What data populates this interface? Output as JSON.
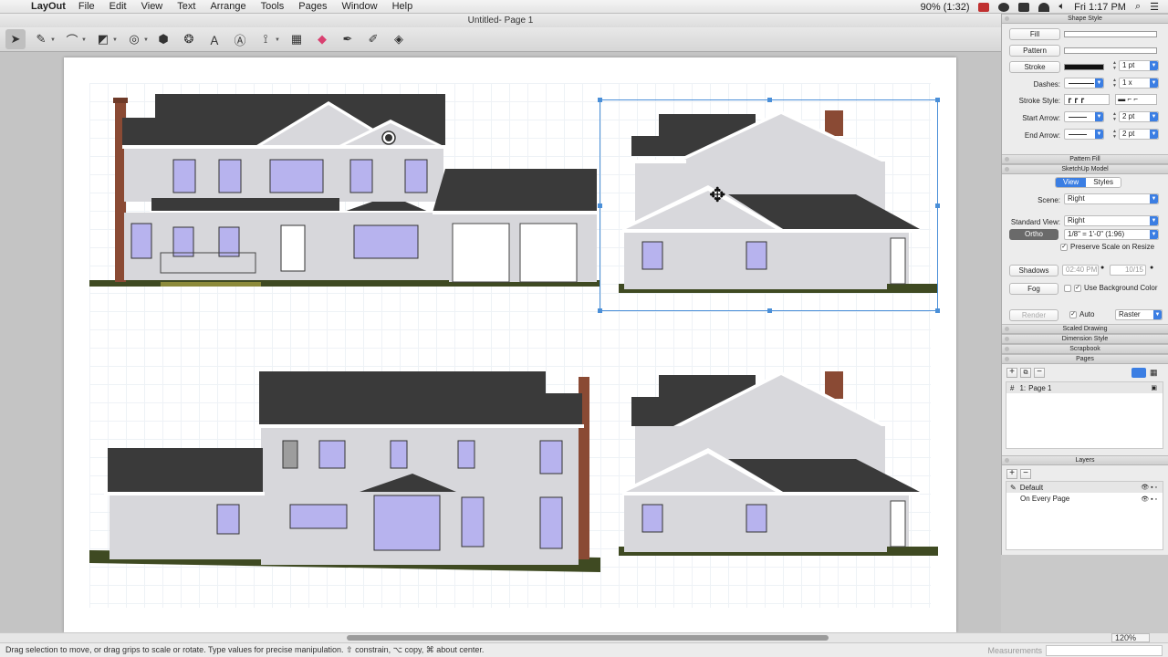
{
  "menubar": {
    "app": "LayOut",
    "menus": [
      "File",
      "Edit",
      "View",
      "Text",
      "Arrange",
      "Tools",
      "Pages",
      "Window",
      "Help"
    ],
    "battery": "90% (1:32)",
    "clock": "Fri 1:17 PM"
  },
  "window": {
    "title": "Untitled- Page 1"
  },
  "toolbar": {
    "tools": [
      "select-tool",
      "pencil-tool",
      "arc-tool",
      "shape-tool",
      "circle-tool",
      "rotate-tool",
      "split-tool",
      "text-tool",
      "label-tool",
      "dimension-tool",
      "table-tool",
      "eraser-tool",
      "style-tool",
      "sample-tool",
      "paint-bucket-tool"
    ]
  },
  "canvas": {
    "zoom": "120%",
    "accent": "#4a8fd8"
  },
  "status": {
    "hint": "Drag selection to move, or drag grips to scale or rotate. Type values for precise manipulation. ⇧ constrain, ⌥ copy, ⌘ about center.",
    "measurements_label": "Measurements"
  },
  "panel": {
    "shape_style": {
      "title": "Shape Style",
      "fill": "Fill",
      "pattern": "Pattern",
      "stroke": "Stroke",
      "stroke_width": "1 pt",
      "dashes_label": "Dashes:",
      "dashes_scale": "1 x",
      "stroke_style_label": "Stroke Style:",
      "start_arrow_label": "Start Arrow:",
      "start_arrow_size": "2 pt",
      "end_arrow_label": "End Arrow:",
      "end_arrow_size": "2 pt"
    },
    "pattern_fill": {
      "title": "Pattern Fill"
    },
    "sketchup_model": {
      "title": "SketchUp Model",
      "tab_view": "View",
      "tab_styles": "Styles",
      "scene_label": "Scene:",
      "scene_value": "Right",
      "standard_view_label": "Standard View:",
      "standard_view_value": "Right",
      "ortho": "Ortho",
      "scale_value": "1/8\" = 1'-0\" (1:96)",
      "preserve_scale": "Preserve Scale on Resize",
      "shadows": "Shadows",
      "shadow_time": "02:40 PM",
      "shadow_date": "10/15",
      "fog": "Fog",
      "use_background": "Use Background Color",
      "render": "Render",
      "auto": "Auto",
      "render_mode": "Raster"
    },
    "collapsed": [
      "Scaled Drawing",
      "Dimension Style",
      "Scrapbook"
    ],
    "pages": {
      "title": "Pages",
      "items": [
        {
          "num": "1:",
          "name": "Page 1"
        }
      ]
    },
    "layers": {
      "title": "Layers",
      "items": [
        "Default",
        "On Every Page"
      ]
    }
  }
}
